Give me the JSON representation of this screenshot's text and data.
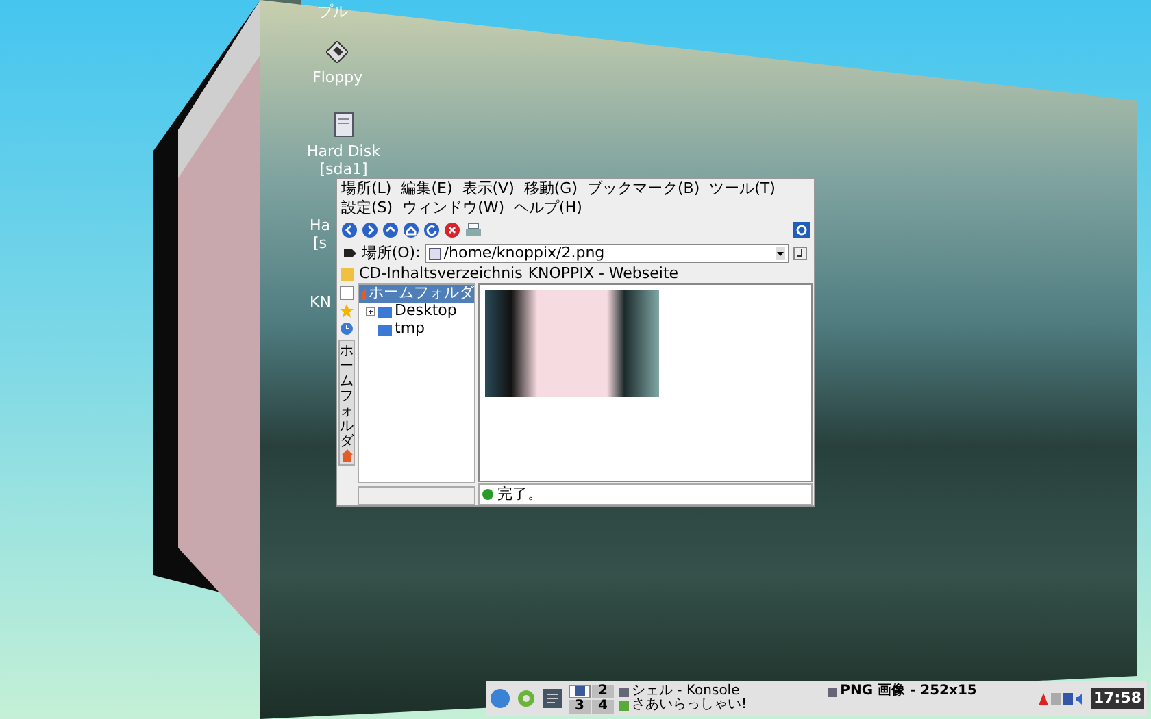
{
  "desktop_icons": [
    {
      "kind": "none",
      "lines": [
        "プル"
      ]
    },
    {
      "kind": "floppy",
      "lines": [
        "Floppy"
      ]
    },
    {
      "kind": "disk",
      "lines": [
        "Hard Disk",
        "[sda1]"
      ]
    },
    {
      "kind": "none",
      "lines": [
        "Ha",
        "[s"
      ]
    },
    {
      "kind": "none",
      "lines": [
        "KN"
      ]
    }
  ],
  "window": {
    "menu": [
      {
        "label": "場所(L)"
      },
      {
        "label": "編集(E)"
      },
      {
        "label": "表示(V)"
      },
      {
        "label": "移動(G)"
      },
      {
        "label": "ブックマーク(B)"
      },
      {
        "label": "ツール(T)"
      },
      {
        "label": "設定(S)"
      },
      {
        "label": "ウィンドウ(W)"
      },
      {
        "label": "ヘルプ(H)"
      }
    ],
    "location": {
      "label": "場所(O):",
      "value": "/home/knoppix/2.png"
    },
    "bookmarks": [
      {
        "label": "CD-Inhaltsverzeichnis"
      },
      {
        "label": "KNOPPIX - Webseite"
      }
    ],
    "side_tab": "ホームフォルダ",
    "tree": [
      {
        "label": "ホームフォルダ",
        "selected": true,
        "children": [
          {
            "label": "Desktop",
            "expanded": false
          },
          {
            "label": "tmp"
          }
        ]
      }
    ],
    "status": "完了。"
  },
  "taskbar": {
    "pager": [
      {
        "selected": true
      },
      {
        "label": "2",
        "selected": false
      },
      {
        "label": "3",
        "selected": false
      },
      {
        "label": "4",
        "selected": false
      }
    ],
    "tasks": [
      {
        "label": "シェル - Konsole"
      },
      {
        "label": "さあいらっしゃい!"
      },
      {
        "label": "PNG 画像 - 252x15"
      }
    ],
    "clock": "17:58"
  }
}
